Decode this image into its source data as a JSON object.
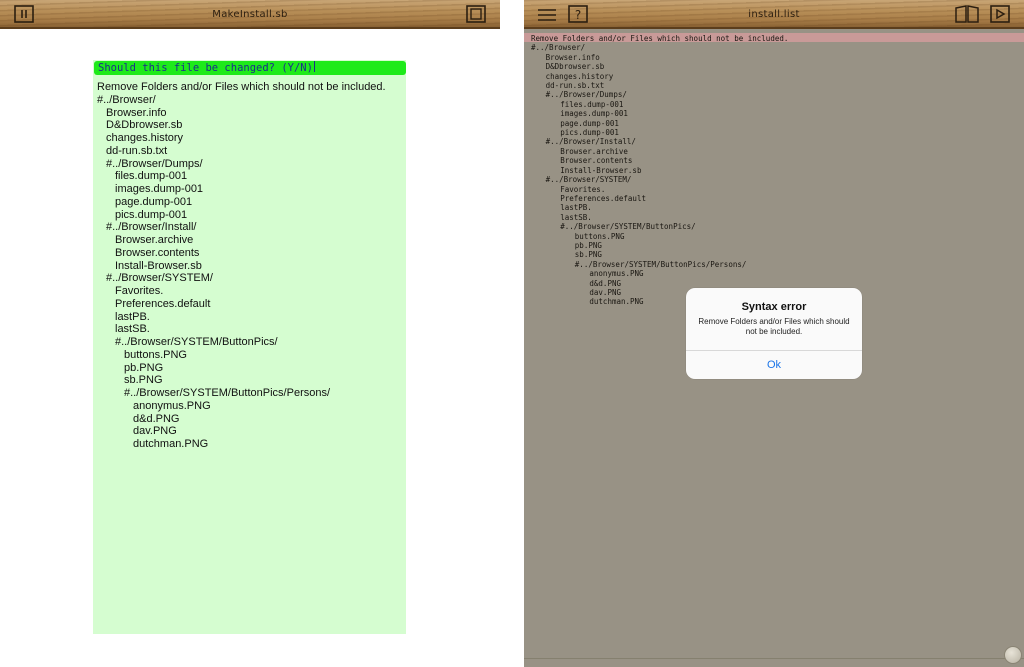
{
  "left": {
    "title": "MakeInstall.sb",
    "prompt": "Should this file be changed? (Y/N)",
    "lines": [
      {
        "indent": 0,
        "text": "Remove Folders and/or Files which should not be included."
      },
      {
        "indent": 0,
        "text": "#../Browser/"
      },
      {
        "indent": 1,
        "text": "Browser.info"
      },
      {
        "indent": 1,
        "text": "D&Dbrowser.sb"
      },
      {
        "indent": 1,
        "text": "changes.history"
      },
      {
        "indent": 1,
        "text": "dd-run.sb.txt"
      },
      {
        "indent": 1,
        "text": "#../Browser/Dumps/"
      },
      {
        "indent": 2,
        "text": "files.dump-001"
      },
      {
        "indent": 2,
        "text": "images.dump-001"
      },
      {
        "indent": 2,
        "text": "page.dump-001"
      },
      {
        "indent": 2,
        "text": "pics.dump-001"
      },
      {
        "indent": 1,
        "text": "#../Browser/Install/"
      },
      {
        "indent": 2,
        "text": "Browser.archive"
      },
      {
        "indent": 2,
        "text": "Browser.contents"
      },
      {
        "indent": 2,
        "text": "Install-Browser.sb"
      },
      {
        "indent": 1,
        "text": "#../Browser/SYSTEM/"
      },
      {
        "indent": 2,
        "text": "Favorites."
      },
      {
        "indent": 2,
        "text": "Preferences.default"
      },
      {
        "indent": 2,
        "text": "lastPB."
      },
      {
        "indent": 2,
        "text": "lastSB."
      },
      {
        "indent": 2,
        "text": "#../Browser/SYSTEM/ButtonPics/"
      },
      {
        "indent": 3,
        "text": "buttons.PNG"
      },
      {
        "indent": 3,
        "text": "pb.PNG"
      },
      {
        "indent": 3,
        "text": "sb.PNG"
      },
      {
        "indent": 3,
        "text": "#../Browser/SYSTEM/ButtonPics/Persons/"
      },
      {
        "indent": 4,
        "text": "anonymus.PNG"
      },
      {
        "indent": 4,
        "text": "d&d.PNG"
      },
      {
        "indent": 4,
        "text": "dav.PNG"
      },
      {
        "indent": 4,
        "text": "dutchman.PNG"
      }
    ]
  },
  "right": {
    "title": "install.list",
    "lines": [
      {
        "indent": 0,
        "text": "Remove Folders and/or Files which should not be included."
      },
      {
        "indent": 0,
        "text": "#../Browser/"
      },
      {
        "indent": 1,
        "text": "Browser.info"
      },
      {
        "indent": 1,
        "text": "D&Dbrowser.sb"
      },
      {
        "indent": 1,
        "text": "changes.history"
      },
      {
        "indent": 1,
        "text": "dd-run.sb.txt"
      },
      {
        "indent": 1,
        "text": "#../Browser/Dumps/"
      },
      {
        "indent": 2,
        "text": "files.dump-001"
      },
      {
        "indent": 2,
        "text": "images.dump-001"
      },
      {
        "indent": 2,
        "text": "page.dump-001"
      },
      {
        "indent": 2,
        "text": "pics.dump-001"
      },
      {
        "indent": 1,
        "text": "#../Browser/Install/"
      },
      {
        "indent": 2,
        "text": "Browser.archive"
      },
      {
        "indent": 2,
        "text": "Browser.contents"
      },
      {
        "indent": 2,
        "text": "Install-Browser.sb"
      },
      {
        "indent": 1,
        "text": "#../Browser/SYSTEM/"
      },
      {
        "indent": 2,
        "text": "Favorites."
      },
      {
        "indent": 2,
        "text": "Preferences.default"
      },
      {
        "indent": 2,
        "text": "lastPB."
      },
      {
        "indent": 2,
        "text": "lastSB."
      },
      {
        "indent": 2,
        "text": "#../Browser/SYSTEM/ButtonPics/"
      },
      {
        "indent": 3,
        "text": "buttons.PNG"
      },
      {
        "indent": 3,
        "text": "pb.PNG"
      },
      {
        "indent": 3,
        "text": "sb.PNG"
      },
      {
        "indent": 3,
        "text": "#../Browser/SYSTEM/ButtonPics/Persons/"
      },
      {
        "indent": 4,
        "text": "anonymus.PNG"
      },
      {
        "indent": 4,
        "text": "d&d.PNG"
      },
      {
        "indent": 4,
        "text": "dav.PNG"
      },
      {
        "indent": 4,
        "text": "dutchman.PNG"
      }
    ]
  },
  "alert": {
    "title": "Syntax error",
    "message": "Remove Folders and/or Files which should not be included.",
    "button_label": "Ok"
  },
  "icons": {
    "left_toolbar": [
      "pause-icon",
      "window-icon"
    ],
    "right_toolbar_left": [
      "menu-icon",
      "help-icon"
    ],
    "right_toolbar_right": [
      "book-icon",
      "play-icon"
    ]
  },
  "colors": {
    "editor_background": "#d5fdd0",
    "prompt_background": "#1eea1a",
    "prompt_text": "#1b2f8a",
    "right_background": "#989285",
    "highlight_line": "#c99a98",
    "alert_button": "#1a74e8"
  }
}
